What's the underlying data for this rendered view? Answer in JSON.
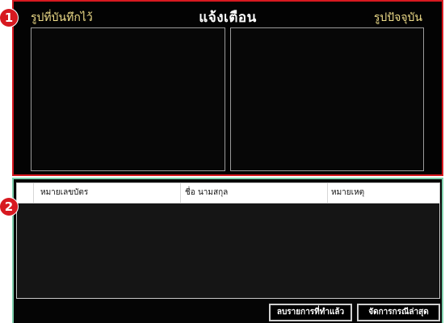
{
  "alert_panel": {
    "title": "แจ้งเตือน",
    "saved_photo_label": "รูปที่บันทึกไว้",
    "current_photo_label": "รูปปัจจุบัน"
  },
  "list_panel": {
    "columns": [
      "หมายเลขบัตร",
      "ชื่อ นามสกุล",
      "หมายเหตุ"
    ],
    "delete_done_button": "ลบรายการที่ทำแล้ว",
    "manage_latest_button": "จัดการกรณีล่าสุด"
  },
  "markers": {
    "section_1": "1",
    "section_2": "2"
  },
  "colors": {
    "alert_border": "#d71920",
    "list_border": "#7fd0ad",
    "photo_label": "#f0de8a",
    "panel_background": "#030303"
  }
}
